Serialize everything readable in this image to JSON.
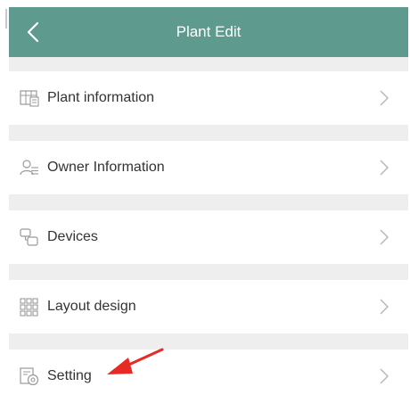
{
  "header": {
    "title": "Plant Edit",
    "back_icon": "chevron-left-icon",
    "background": "#5f9a8f"
  },
  "menu": {
    "items": [
      {
        "label": "Plant information",
        "icon": "plant-info-icon"
      },
      {
        "label": "Owner Information",
        "icon": "owner-icon"
      },
      {
        "label": "Devices",
        "icon": "devices-icon"
      },
      {
        "label": "Layout design",
        "icon": "layout-grid-icon"
      },
      {
        "label": "Setting",
        "icon": "settings-icon"
      }
    ]
  },
  "annotation": {
    "icon": "red-arrow-icon",
    "color": "#e82a25"
  }
}
